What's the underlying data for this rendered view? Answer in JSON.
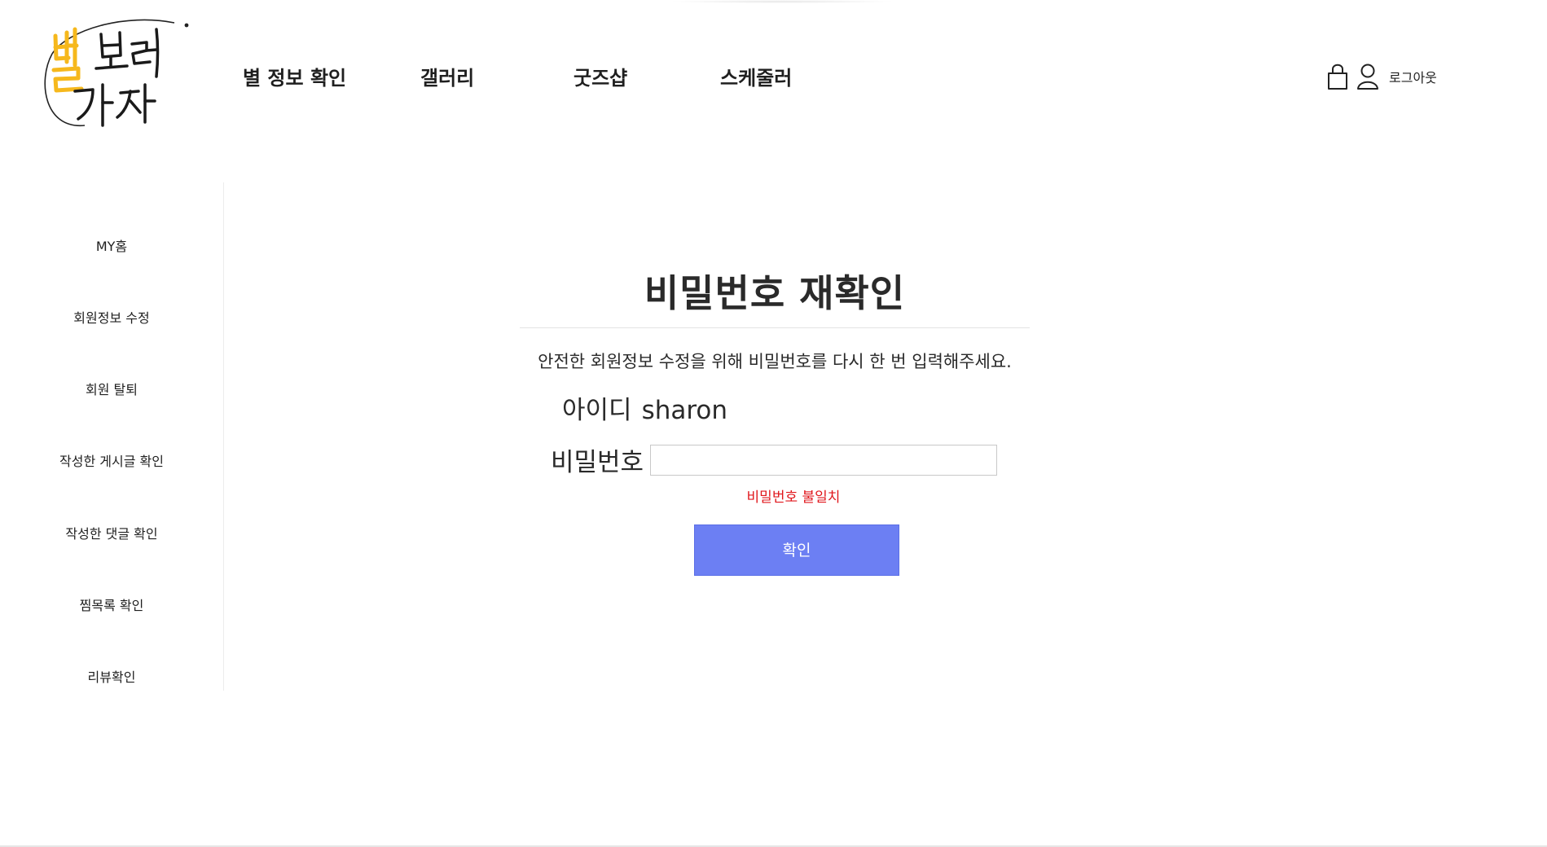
{
  "header": {
    "logo": {
      "text_top": "별 보러",
      "text_bottom": "가자"
    },
    "nav": [
      {
        "label": "별 정보 확인"
      },
      {
        "label": "갤러리"
      },
      {
        "label": "굿즈샵"
      },
      {
        "label": "스케줄러"
      }
    ],
    "icons": {
      "cart": "shopping-bag-icon",
      "user": "user-icon"
    },
    "logout_label": "로그아웃"
  },
  "sidebar": {
    "items": [
      {
        "label": "MY홈"
      },
      {
        "label": "회원정보 수정"
      },
      {
        "label": "회원 탈퇴"
      },
      {
        "label": "작성한 게시글 확인"
      },
      {
        "label": "작성한 댓글 확인"
      },
      {
        "label": "찜목록 확인"
      },
      {
        "label": "리뷰확인"
      }
    ]
  },
  "main": {
    "title": "비밀번호 재확인",
    "description": "안전한 회원정보 수정을 위해 비밀번호를 다시 한 번 입력해주세요.",
    "id_label": "아이디",
    "id_value": "sharon",
    "password_label": "비밀번호",
    "password_value": "",
    "error_message": "비밀번호 불일치",
    "confirm_label": "확인"
  },
  "colors": {
    "accent": "#6c7ff3",
    "error": "#e0161b",
    "logo_yellow": "#f6b81c"
  }
}
